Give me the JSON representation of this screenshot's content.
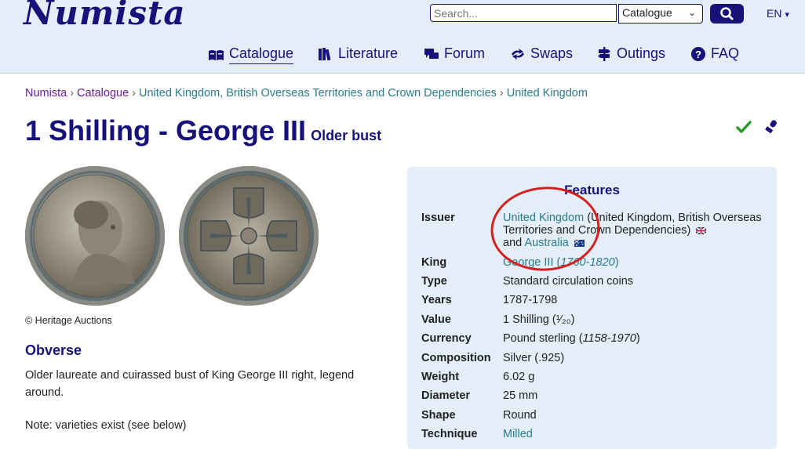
{
  "header": {
    "logo": "Numista",
    "search_placeholder": "Search...",
    "search_scope": "Catalogue",
    "language": "EN"
  },
  "nav": [
    {
      "label": "Catalogue",
      "icon": "catalogue-icon",
      "active": true
    },
    {
      "label": "Literature",
      "icon": "books-icon"
    },
    {
      "label": "Forum",
      "icon": "forum-icon"
    },
    {
      "label": "Swaps",
      "icon": "swaps-icon"
    },
    {
      "label": "Outings",
      "icon": "signpost-icon"
    },
    {
      "label": "FAQ",
      "icon": "help-icon"
    }
  ],
  "breadcrumb": [
    "Numista",
    "Catalogue",
    "United Kingdom, British Overseas Territories and Crown Dependencies",
    "United Kingdom"
  ],
  "title": "1 Shilling - George III",
  "subtitle": "Older bust",
  "copyright": "© Heritage Auctions",
  "obverse": {
    "heading": "Obverse",
    "text": "Older laureate and cuirassed bust of King George III right, legend around.",
    "note": "Note: varieties exist (see below)"
  },
  "features": {
    "title": "Features",
    "issuer": {
      "label": "Issuer",
      "link1": "United Kingdom",
      "text1": " (United Kingdom, British Overseas Territories and Crown Dependencies)",
      "and": "and",
      "link2": "Australia"
    },
    "rows": [
      {
        "key": "King",
        "value": "George III",
        "extra": "1760-1820"
      },
      {
        "key": "Type",
        "value": "Standard circulation coins"
      },
      {
        "key": "Years",
        "value": "1787-1798"
      },
      {
        "key": "Value",
        "value": "1 Shilling (¹⁄₂₀)"
      },
      {
        "key": "Currency",
        "value": "Pound sterling",
        "extra": "1158-1970"
      },
      {
        "key": "Composition",
        "value": "Silver (.925)"
      },
      {
        "key": "Weight",
        "value": "6.02 g"
      },
      {
        "key": "Diameter",
        "value": "25 mm"
      },
      {
        "key": "Shape",
        "value": "Round"
      },
      {
        "key": "Technique",
        "value": "Milled"
      }
    ]
  },
  "colors": {
    "brand": "#16127a",
    "link": "#2a7a8c",
    "annotation": "#d42020"
  }
}
